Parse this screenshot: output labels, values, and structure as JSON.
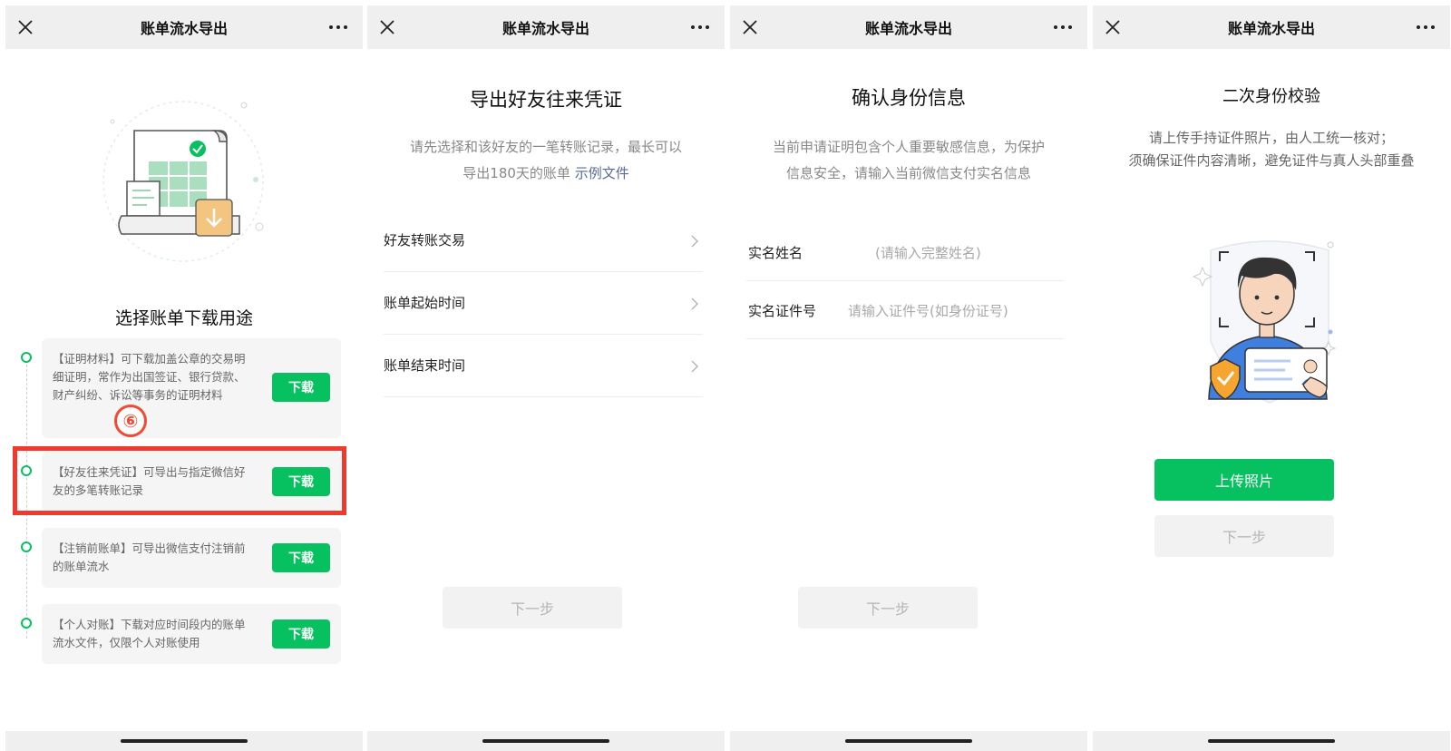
{
  "panels": {
    "purpose": {
      "nav_title": "账单流水导出",
      "heading": "选择账单下载用途",
      "options": [
        {
          "text": "【证明材料】可下载加盖公章的交易明细证明，常作为出国签证、银行贷款、财产纠纷、诉讼等事务的证明材料",
          "button": "下载"
        },
        {
          "text": "【好友往来凭证】可导出与指定微信好友的多笔转账记录",
          "button": "下载"
        },
        {
          "text": "【注销前账单】可导出微信支付注销前的账单流水",
          "button": "下载"
        },
        {
          "text": "【个人对账】下载对应时间段内的账单流水文件，仅限个人对账使用",
          "button": "下载"
        }
      ],
      "step_marker": "⑥"
    },
    "friend_export": {
      "nav_title": "账单流水导出",
      "title": "导出好友往来凭证",
      "desc_line1": "请先选择和该好友的一笔转账记录，最长可以",
      "desc_line2": "导出180天的账单",
      "example_link": "示例文件",
      "rows": [
        "好友转账交易",
        "账单起始时间",
        "账单结束时间"
      ],
      "next_button": "下一步"
    },
    "identity": {
      "nav_title": "账单流水导出",
      "title": "确认身份信息",
      "desc_line1": "当前申请证明包含个人重要敏感信息，为保护",
      "desc_line2": "信息安全，请输入当前微信支付实名信息",
      "fields": [
        {
          "label": "实名姓名",
          "placeholder": "(请输入完整姓名)"
        },
        {
          "label": "实名证件号",
          "placeholder": "请输入证件号(如身份证号)"
        }
      ],
      "next_button": "下一步"
    },
    "verify": {
      "nav_title": "账单流水导出",
      "title": "二次身份校验",
      "desc_line1": "请上传手持证件照片，由人工统一核对；",
      "desc_line2": "须确保证件内容清晰，避免证件与真人头部重叠",
      "upload_button": "上传照片",
      "next_button": "下一步"
    }
  },
  "colors": {
    "brand_green": "#07c160",
    "highlight_red": "#ee3b2f",
    "link_blue": "#576b95",
    "navbar_bg": "#efefef"
  },
  "icons": [
    "close-icon",
    "more-icon",
    "chevron-right-icon",
    "download-icon",
    "shield-check-icon"
  ]
}
